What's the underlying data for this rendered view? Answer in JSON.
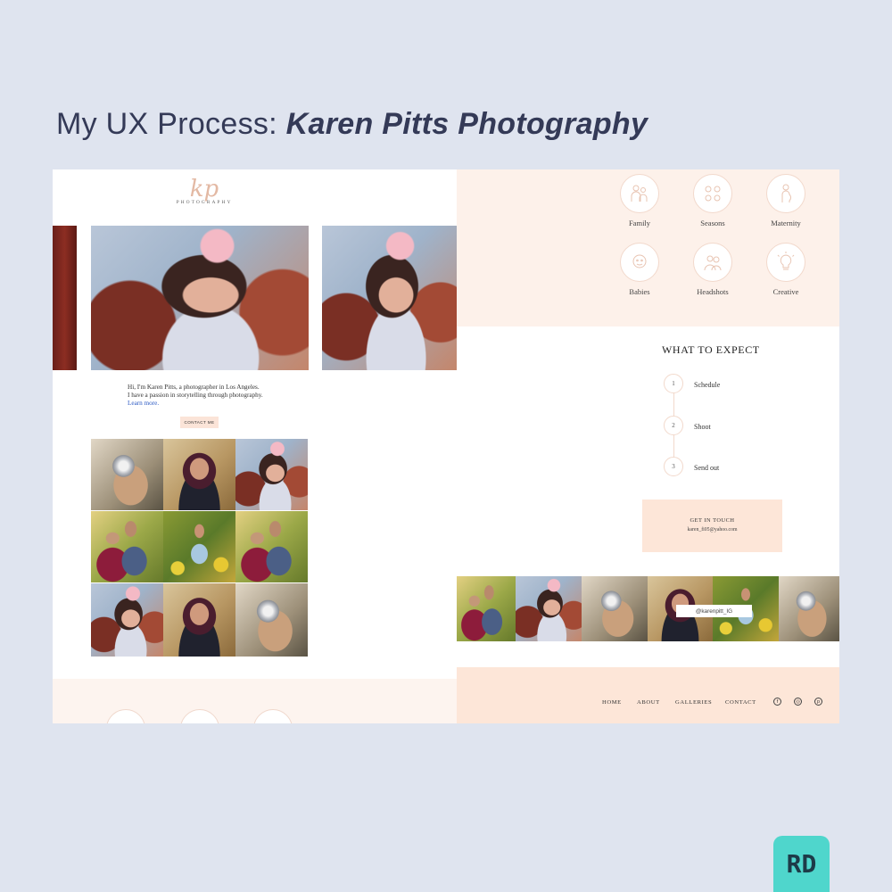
{
  "heading": {
    "prefix": "My UX Process: ",
    "project": "Karen Pitts Photography"
  },
  "logo": {
    "script": "kp",
    "word": "PHOTOGRAPHY"
  },
  "intro": {
    "line1": "Hi, I'm Karen Pitts, a photographer in Los Angeles.",
    "line2": "I have a passion in storytelling through photography.",
    "link": "Learn more."
  },
  "contact_button": "CONTACT ME",
  "categories": [
    {
      "label": "Family",
      "icon": "family-icon"
    },
    {
      "label": "Seasons",
      "icon": "seasons-icon"
    },
    {
      "label": "Maternity",
      "icon": "maternity-icon"
    },
    {
      "label": "Babies",
      "icon": "babies-icon"
    },
    {
      "label": "Headshots",
      "icon": "headshots-icon"
    },
    {
      "label": "Creative",
      "icon": "creative-icon"
    }
  ],
  "expect": {
    "title": "WHAT TO EXPECT",
    "steps": [
      {
        "num": "1",
        "label": "Schedule"
      },
      {
        "num": "2",
        "label": "Shoot"
      },
      {
        "num": "3",
        "label": "Send out"
      }
    ]
  },
  "touch": {
    "title": "GET IN TOUCH",
    "email": "karen_fi05@yahoo.com"
  },
  "instagram": {
    "handle": "@karenpitt_IG"
  },
  "footer": {
    "nav": [
      "HOME",
      "ABOUT",
      "GALLERIES",
      "CONTACT"
    ],
    "social": [
      "f",
      "◎",
      "p"
    ]
  },
  "badge": "RD",
  "colors": {
    "peach": "#fde6d8",
    "accent_link": "#2b59c3",
    "badge": "#4fd6cc"
  }
}
